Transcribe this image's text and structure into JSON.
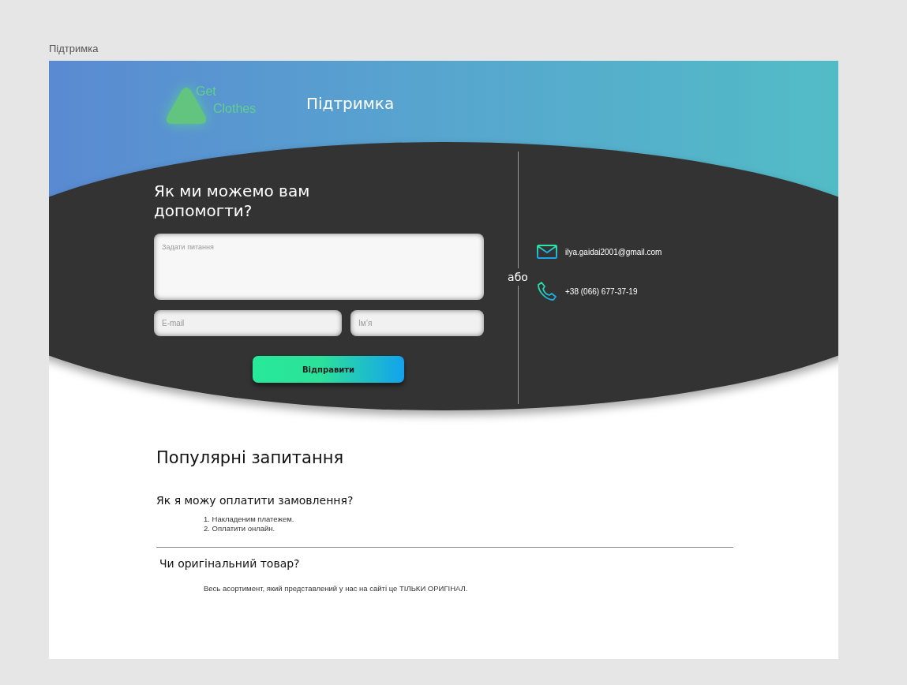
{
  "canvas_label": "Підтримка",
  "header": {
    "logo": {
      "line_1": "Get",
      "line_2": "Clothes"
    },
    "title": "Підтримка"
  },
  "contact_form": {
    "heading": "Як ми можемо вам допомогти?",
    "question": {
      "placeholder": "Задати питання"
    },
    "email": {
      "placeholder": "E-mail"
    },
    "name": {
      "placeholder": "Ім’я"
    },
    "submit": "Відправити"
  },
  "separator": "або",
  "contacts": [
    {
      "kind": "email",
      "text": "ilya.gaidai2001@gmail.com"
    },
    {
      "kind": "phone",
      "text": "+38 (066) 677-37-19"
    }
  ],
  "faq": {
    "title": "Популярні запитання",
    "items": [
      {
        "kind": "list",
        "question": "Як я можу оплатити замовлення?",
        "answers": [
          {
            "marker": "1.",
            "text": "Накладеним платежем."
          },
          {
            "marker": "2.",
            "text": "Оплатити онлайн."
          }
        ]
      },
      {
        "kind": "text",
        "question": "Чи оригінальний товар?",
        "answers": [
          {
            "text": "Весь асортимент, який представлений у нас на сайті це ТІЛЬКИ ОРИГІНАЛ."
          }
        ]
      }
    ]
  }
}
